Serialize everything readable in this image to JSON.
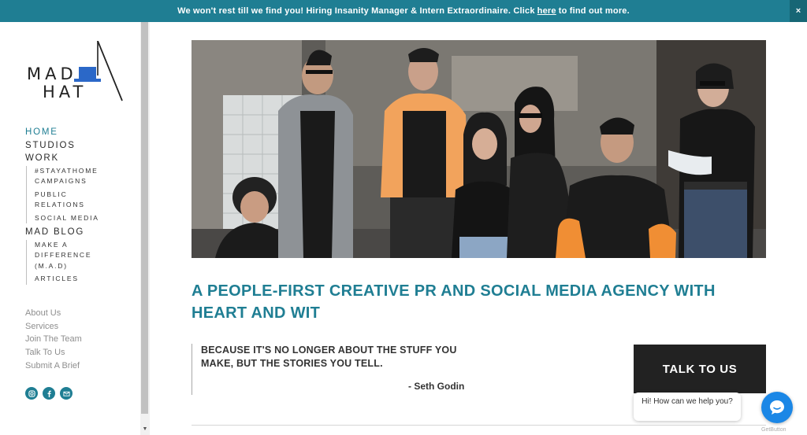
{
  "banner": {
    "text_before": "We won't rest till we find you! Hiring Insanity Manager & Intern Extraordinaire. Click",
    "link": "here",
    "text_after": "to find out more.",
    "close": "×"
  },
  "logo": {
    "line1": "MAD",
    "line2": "HAT"
  },
  "nav": {
    "home": "HOME",
    "studios": "STUDIOS",
    "work": "WORK",
    "work_items": [
      "#STAYATHOME CAMPAIGNS",
      "PUBLIC RELATIONS",
      "SOCIAL MEDIA"
    ],
    "blog": "MAD BLOG",
    "blog_items": [
      "MAKE A DIFFERENCE (M.A.D)",
      "ARTICLES"
    ]
  },
  "footer_links": [
    "About Us",
    "Services",
    "Join The Team",
    "Talk To Us",
    "Submit A Brief"
  ],
  "socials": [
    "instagram-icon",
    "facebook-icon",
    "email-icon"
  ],
  "headline": "A PEOPLE-FIRST CREATIVE PR AND SOCIAL MEDIA AGENCY WITH HEART AND WIT",
  "quote": {
    "text": "BECAUSE IT'S NO LONGER ABOUT THE STUFF YOU MAKE, BUT THE STORIES YOU TELL.",
    "author": "- Seth Godin"
  },
  "cta": "TALK TO US",
  "chat": {
    "prompt": "Hi! How can we help you?",
    "brand": "GetButton"
  },
  "colors": {
    "accent": "#1f7e93",
    "cta": "#222222",
    "chat": "#1b87e6"
  }
}
